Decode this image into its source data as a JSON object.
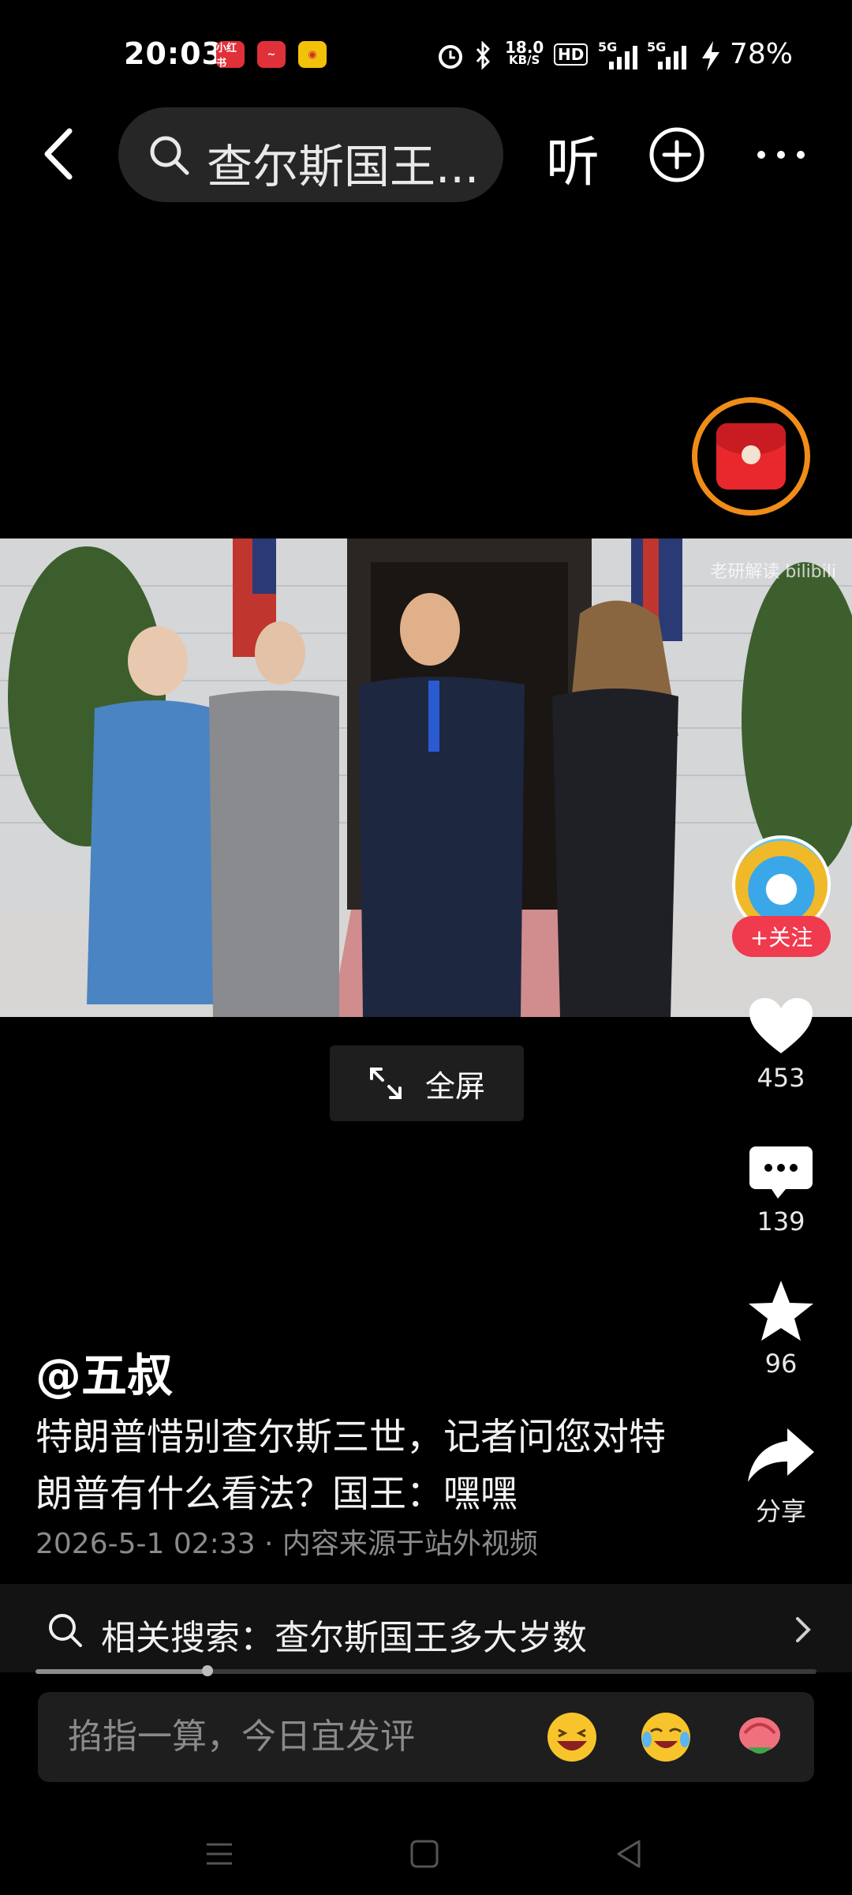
{
  "status_bar": {
    "time": "20:03",
    "apps": [
      "小红书",
      "red-app",
      "weibo"
    ],
    "network_speed": "18.0",
    "network_unit": "KB/S",
    "hd": "HD",
    "signal1": "5G",
    "signal2": "5G",
    "battery": "78%"
  },
  "nav": {
    "search_text": "查尔斯国王...",
    "listen_label": "听"
  },
  "video": {
    "watermark": "老研解读 bilibili"
  },
  "actions": {
    "follow_label": "+关注",
    "likes": "453",
    "comments": "139",
    "favorites": "96",
    "share_label": "分享"
  },
  "fullscreen_label": "全屏",
  "post": {
    "author": "@五叔",
    "description": "特朗普惜别查尔斯三世，记者问您对特朗普有什么看法？国王：嘿嘿",
    "meta": "2026-5-1 02:33 · 内容来源于站外视频"
  },
  "related": {
    "text": "相关搜索：查尔斯国王多大岁数",
    "progress": 0.22
  },
  "comment": {
    "placeholder": "掐指一算，今日宜发评"
  },
  "colors": {
    "accent_red": "#f03a4e",
    "envelope_ring": "#f08c18"
  }
}
